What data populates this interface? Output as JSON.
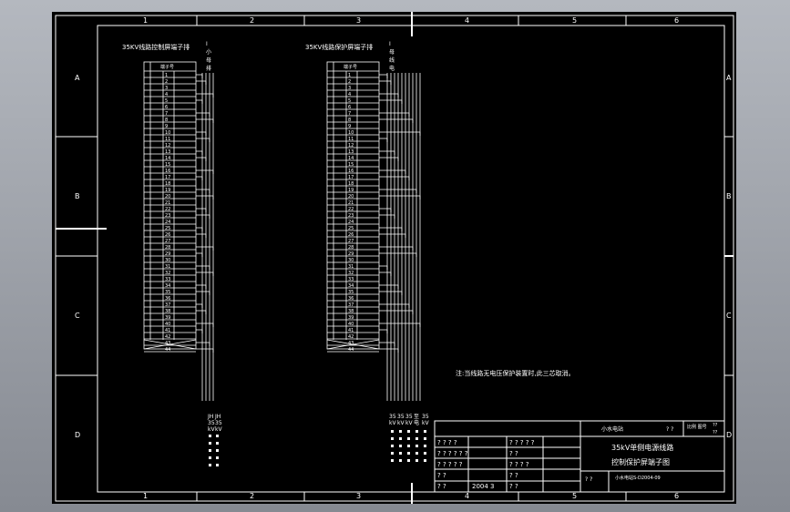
{
  "columns": [
    "1",
    "2",
    "3",
    "4",
    "5",
    "6"
  ],
  "rows": [
    "A",
    "B",
    "C",
    "D"
  ],
  "colors": {
    "background": "#000000",
    "lines": "#ffffff",
    "viewer": "#9a9ea6"
  },
  "left_strip": {
    "title": "35KV线路控制屏端子排",
    "header": "端子号",
    "side_labels": [
      "I",
      "小",
      "母",
      "排"
    ],
    "terminals": [
      "1",
      "2",
      "3",
      "4",
      "5",
      "6",
      "7",
      "8",
      "9",
      "10",
      "11",
      "12",
      "13",
      "14",
      "15",
      "16",
      "17",
      "18",
      "19",
      "20",
      "21",
      "22",
      "23",
      "24",
      "25",
      "26",
      "27",
      "28",
      "29",
      "30",
      "31",
      "32",
      "33",
      "34",
      "35",
      "36",
      "37",
      "38",
      "39",
      "40",
      "41",
      "42",
      "43",
      "44"
    ],
    "bottom_labels": [
      "JH",
      "JH"
    ],
    "bottom_values": [
      "35",
      "35"
    ],
    "bottom_units": [
      "kV",
      "kV"
    ]
  },
  "right_strip": {
    "title": "35KV线路保护屏端子排",
    "header": "端子号",
    "side_labels": [
      "I",
      "母",
      "线",
      "电"
    ],
    "terminals": [
      "1",
      "2",
      "3",
      "4",
      "5",
      "6",
      "7",
      "8",
      "9",
      "10",
      "11",
      "12",
      "13",
      "14",
      "15",
      "16",
      "17",
      "18",
      "19",
      "20",
      "21",
      "22",
      "23",
      "24",
      "25",
      "26",
      "27",
      "28",
      "29",
      "30",
      "31",
      "32",
      "33",
      "34",
      "35",
      "36",
      "37",
      "38",
      "39",
      "40",
      "41",
      "42",
      "43",
      "44"
    ],
    "bottom_values": [
      "35",
      "35",
      "35",
      "至",
      "35"
    ],
    "bottom_units": [
      "kV",
      "kV",
      "kV",
      "电",
      "kV"
    ]
  },
  "note": "注:当线路无电压保护装置时,此三芯取消。",
  "title_block": {
    "company": "小水电站",
    "company_code": "? ?",
    "scale_label": "比例 图号",
    "sheet": "??",
    "sheet2": "??",
    "drawing_title_1": "35kV单侧电源线路",
    "drawing_title_2": "控制保护屏端子图",
    "drawing_number": "小水电站S-D2004-09",
    "drawing_number_prefix": "?  ?",
    "rows": [
      [
        "? ? ? ?",
        "",
        "? ? ? ? ?",
        ""
      ],
      [
        "? ? ? ? ? ?",
        "",
        "?      ?",
        ""
      ],
      [
        "? ? ? ? ?",
        "",
        "? ? ? ?",
        ""
      ],
      [
        "?      ?",
        "",
        "?      ?",
        ""
      ],
      [
        "?      ?",
        "2004 3",
        "?      ?",
        ""
      ]
    ]
  }
}
